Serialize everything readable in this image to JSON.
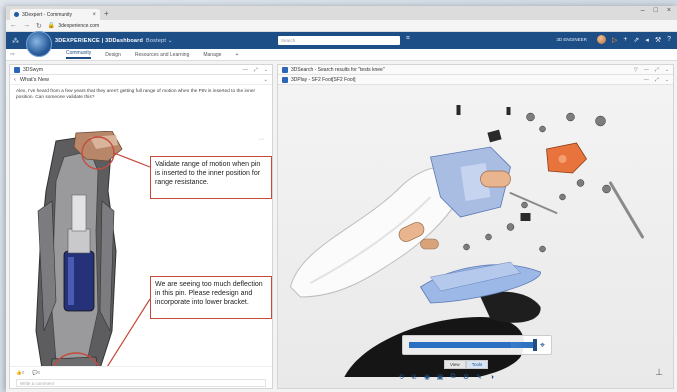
{
  "browser": {
    "tab_title": "3Dexpert - Community",
    "url": "3dexperience.com",
    "new_tab": "+",
    "window_controls": [
      "–",
      "□",
      "×"
    ]
  },
  "topbar": {
    "brand_bold": "3DEXPERIENCE | 3DDashboard",
    "brand_rest": "Bostept ⌄",
    "search_placeholder": "Search",
    "user": "3D ENGINEER",
    "icons": [
      "user-avatar",
      "share-icon",
      "add-icon",
      "share-alt-icon",
      "tag-icon",
      "help-icon"
    ]
  },
  "tabs": [
    {
      "label": "Community",
      "active": true
    },
    {
      "label": "Design",
      "active": false
    },
    {
      "label": "Resources and Learning",
      "active": false
    },
    {
      "label": "Manage",
      "active": false
    },
    {
      "label": "+",
      "active": false
    }
  ],
  "left_panel": {
    "title": "3DSwym",
    "section": "What's New",
    "question": "Alex, I've heard from a few years that they aren't getting full range of motion when the PIN is inserted to the inner position. Can someone validate this?",
    "callout_top": "Validate range of motion when pin is inserted to the inner position for range resistance.",
    "callout_bottom": "We are seeing too much deflection in this pin. Please redesign and incorporate into lower bracket.",
    "likes": "👍0",
    "comments": "💬0",
    "comment_placeholder": "Write a comment"
  },
  "right_panel": {
    "search_title": "3DSearch - Search results for \"tests knee\"",
    "play_title": "3DPlay - SF2 Foot[SF2 Foot]",
    "mode_tabs": [
      "View",
      "Tools"
    ],
    "active_mode": "Tools",
    "slider_value": 0.82
  },
  "colors": {
    "topbar": "#1d4e86",
    "accent": "#2c66b8",
    "callout_border": "#c54a3b",
    "orange_part": "#e8733c"
  }
}
